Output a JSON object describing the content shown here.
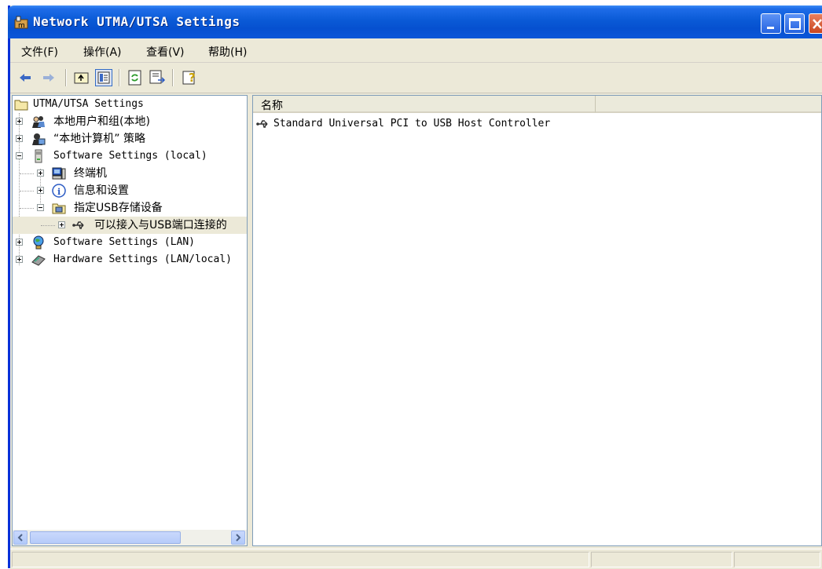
{
  "window": {
    "title": "Network UTMA/UTSA Settings"
  },
  "menu": [
    {
      "label": "文件(F)"
    },
    {
      "label": "操作(A)"
    },
    {
      "label": "查看(V)"
    },
    {
      "label": "帮助(H)"
    }
  ],
  "toolbar": {
    "icons": [
      "back-arrow-icon",
      "forward-arrow-icon",
      "up-folder-icon",
      "show-hide-tree-icon",
      "refresh-icon",
      "export-list-icon",
      "help-icon"
    ]
  },
  "tree": {
    "root": "UTMA/UTSA Settings",
    "items": [
      {
        "label": "本地用户和组(本地)"
      },
      {
        "label": "“本地计算机” 策略"
      },
      {
        "label": "Software Settings (local)"
      },
      {
        "label": "终端机"
      },
      {
        "label": "信息和设置"
      },
      {
        "label": "指定USB存储设备"
      },
      {
        "label": "可以接入与USB端口连接的"
      },
      {
        "label": "Software Settings (LAN)"
      },
      {
        "label": "Hardware Settings (LAN/local)"
      }
    ]
  },
  "list": {
    "columns": [
      "名称",
      ""
    ],
    "rows": [
      {
        "name": "Standard Universal PCI to USB Host Controller"
      }
    ]
  },
  "colors": {
    "titlebar": "#0a5ad6",
    "chrome": "#ece9d8",
    "selection_border": "#316ac5"
  }
}
